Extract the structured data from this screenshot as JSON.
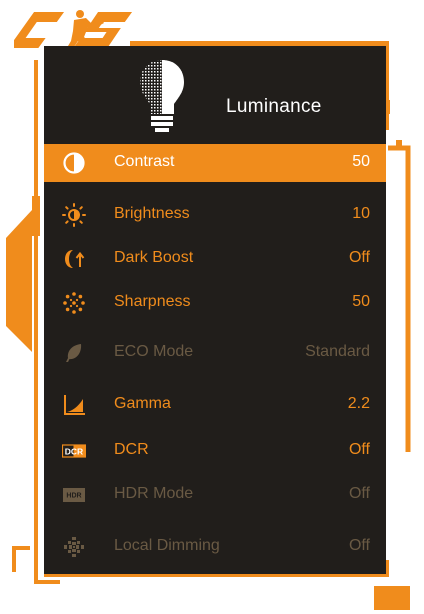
{
  "brand": {
    "logo_text": "CS",
    "accent": "#f08c1c",
    "panel_bg": "#211e1b",
    "disabled_color": "#6a5a44"
  },
  "header": {
    "title": "Luminance",
    "icon": "lightbulb-icon"
  },
  "menu": [
    {
      "label": "Contrast",
      "value": "50",
      "icon": "contrast-icon",
      "state": "selected"
    },
    {
      "label": "Brightness",
      "value": "10",
      "icon": "brightness-icon",
      "state": "normal"
    },
    {
      "label": "Dark Boost",
      "value": "Off",
      "icon": "dark-boost-icon",
      "state": "normal"
    },
    {
      "label": "Sharpness",
      "value": "50",
      "icon": "sharpness-icon",
      "state": "normal"
    },
    {
      "label": "ECO Mode",
      "value": "Standard",
      "icon": "leaf-icon",
      "state": "disabled"
    },
    {
      "label": "Gamma",
      "value": "2.2",
      "icon": "gamma-icon",
      "state": "normal"
    },
    {
      "label": "DCR",
      "value": "Off",
      "icon": "dcr-icon",
      "icon_text": "DCR",
      "state": "normal"
    },
    {
      "label": "HDR Mode",
      "value": "Off",
      "icon": "hdr-icon",
      "icon_text": "HDR",
      "state": "disabled"
    },
    {
      "label": "Local Dimming",
      "value": "Off",
      "icon": "local-dimming-icon",
      "state": "disabled"
    }
  ]
}
